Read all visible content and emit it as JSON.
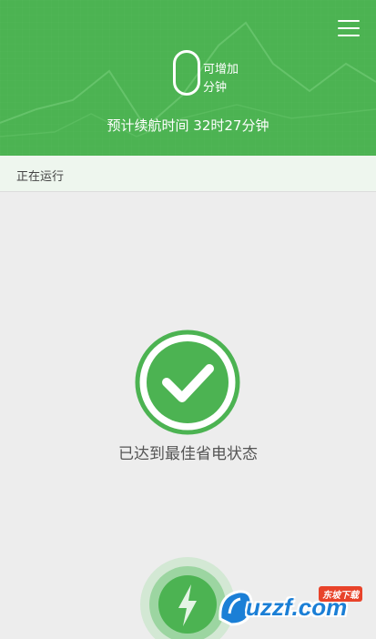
{
  "header": {
    "gain_number": "0",
    "gain_line1": "可增加",
    "gain_line2": "分钟",
    "estimate_text": "预计续航时间 32时27分钟"
  },
  "section": {
    "label": "正在运行"
  },
  "status": {
    "text": "已达到最佳省电状态"
  },
  "icons": {
    "menu": "menu-icon",
    "check": "check-icon",
    "charge": "lightning-icon"
  },
  "watermark": {
    "text": "uzzf.com",
    "tag": "东坡下载"
  },
  "colors": {
    "primary_green": "#4cb352",
    "dark_green": "#3a9a3f",
    "background": "#ededed",
    "section_bg": "#eef6ee"
  }
}
